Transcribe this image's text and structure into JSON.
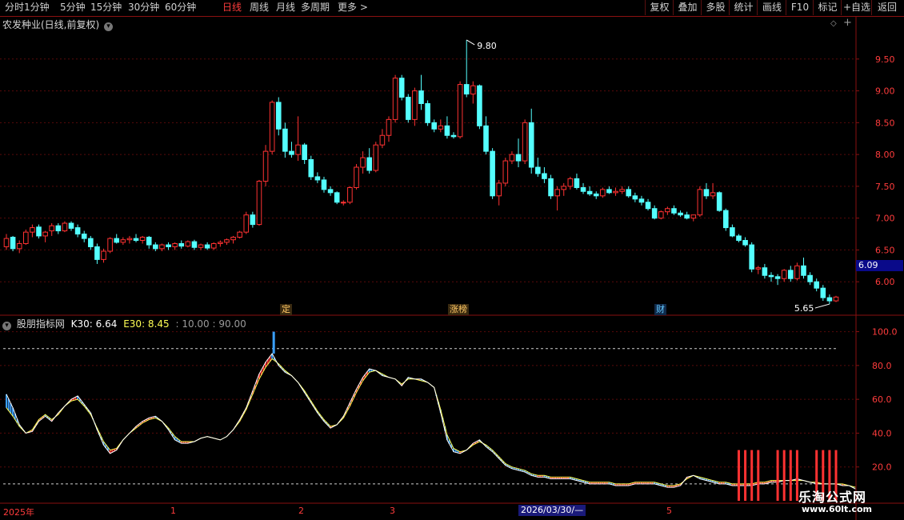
{
  "toolbar": {
    "periods": [
      "分时",
      "1分钟",
      "5分钟",
      "15分钟",
      "30分钟",
      "60分钟",
      "日线",
      "周线",
      "月线",
      "多周期",
      "更多 >"
    ],
    "active_period": "日线",
    "buttons": [
      "复权",
      "叠加",
      "多股",
      "统计",
      "画线",
      "F10",
      "标记",
      "+自选",
      "返回"
    ]
  },
  "stock_title": "农发种业(日线,前复权)",
  "indicator": {
    "name": "股朋指标网",
    "k30_label": "K30: 6.64",
    "e30_label": "E30: 8.45",
    "params": ": 10.00 : 90.00"
  },
  "annotations": {
    "high_label": "9.80",
    "low_label": "5.65",
    "current_price": "6.09",
    "event_1": "定",
    "event_2": "涨榜",
    "event_3": "财"
  },
  "x_axis": {
    "year": "2025年",
    "months": [
      "1",
      "2",
      "3",
      "5"
    ],
    "cursor_date": "2026/03/30/—"
  },
  "watermark": {
    "title": "乐淘公式网",
    "url": "www.60lt.com"
  },
  "colors": {
    "up": "#ff3232",
    "down": "#54ffff",
    "cursor": "#1a1a7a",
    "magenta": "#ff00ff",
    "blue": "#3aa0ff",
    "grid": "#5a0a0a"
  },
  "chart_data": [
    {
      "type": "candlestick",
      "title": "农发种业(日线,前复权)",
      "y_ticks": [
        6.0,
        6.5,
        7.0,
        7.5,
        8.0,
        8.5,
        9.0,
        9.5
      ],
      "ylim": [
        5.55,
        9.95
      ],
      "annotated_high": 9.8,
      "annotated_low": 5.65,
      "last_price": 6.09,
      "ohlc": [
        [
          6.55,
          6.75,
          6.5,
          6.68
        ],
        [
          6.7,
          6.72,
          6.48,
          6.52
        ],
        [
          6.52,
          6.65,
          6.45,
          6.6
        ],
        [
          6.6,
          6.82,
          6.58,
          6.78
        ],
        [
          6.78,
          6.9,
          6.7,
          6.85
        ],
        [
          6.86,
          6.9,
          6.68,
          6.72
        ],
        [
          6.72,
          6.8,
          6.62,
          6.78
        ],
        [
          6.8,
          6.92,
          6.72,
          6.88
        ],
        [
          6.88,
          6.92,
          6.75,
          6.8
        ],
        [
          6.8,
          6.95,
          6.78,
          6.92
        ],
        [
          6.92,
          6.95,
          6.8,
          6.84
        ],
        [
          6.85,
          6.9,
          6.7,
          6.75
        ],
        [
          6.75,
          6.8,
          6.62,
          6.68
        ],
        [
          6.68,
          6.72,
          6.5,
          6.55
        ],
        [
          6.55,
          6.6,
          6.28,
          6.35
        ],
        [
          6.35,
          6.52,
          6.3,
          6.48
        ],
        [
          6.48,
          6.7,
          6.45,
          6.68
        ],
        [
          6.68,
          6.75,
          6.6,
          6.62
        ],
        [
          6.62,
          6.7,
          6.58,
          6.66
        ],
        [
          6.66,
          6.72,
          6.6,
          6.68
        ],
        [
          6.68,
          6.75,
          6.62,
          6.65
        ],
        [
          6.65,
          6.72,
          6.6,
          6.7
        ],
        [
          6.7,
          6.72,
          6.52,
          6.58
        ],
        [
          6.58,
          6.62,
          6.48,
          6.52
        ],
        [
          6.52,
          6.6,
          6.48,
          6.58
        ],
        [
          6.58,
          6.62,
          6.5,
          6.55
        ],
        [
          6.55,
          6.62,
          6.5,
          6.6
        ],
        [
          6.6,
          6.65,
          6.52,
          6.56
        ],
        [
          6.56,
          6.65,
          6.54,
          6.63
        ],
        [
          6.63,
          6.66,
          6.5,
          6.54
        ],
        [
          6.54,
          6.6,
          6.5,
          6.58
        ],
        [
          6.58,
          6.62,
          6.5,
          6.53
        ],
        [
          6.53,
          6.62,
          6.5,
          6.6
        ],
        [
          6.6,
          6.65,
          6.55,
          6.62
        ],
        [
          6.62,
          6.68,
          6.58,
          6.66
        ],
        [
          6.66,
          6.72,
          6.6,
          6.7
        ],
        [
          6.7,
          6.8,
          6.68,
          6.78
        ],
        [
          6.78,
          7.1,
          6.75,
          7.05
        ],
        [
          7.05,
          7.1,
          6.85,
          6.9
        ],
        [
          6.9,
          7.6,
          6.88,
          7.58
        ],
        [
          7.58,
          8.15,
          7.5,
          8.05
        ],
        [
          8.05,
          8.85,
          8.0,
          8.82
        ],
        [
          8.82,
          8.9,
          8.3,
          8.4
        ],
        [
          8.4,
          8.5,
          7.95,
          8.05
        ],
        [
          8.05,
          8.2,
          7.95,
          8.0
        ],
        [
          8.0,
          8.6,
          7.9,
          8.15
        ],
        [
          8.15,
          8.18,
          7.85,
          7.92
        ],
        [
          7.92,
          7.98,
          7.6,
          7.65
        ],
        [
          7.65,
          7.72,
          7.55,
          7.6
        ],
        [
          7.6,
          7.65,
          7.4,
          7.45
        ],
        [
          7.45,
          7.5,
          7.35,
          7.4
        ],
        [
          7.4,
          7.42,
          7.22,
          7.25
        ],
        [
          7.25,
          7.28,
          7.2,
          7.25
        ],
        [
          7.25,
          7.5,
          7.22,
          7.48
        ],
        [
          7.48,
          7.85,
          7.45,
          7.8
        ],
        [
          7.8,
          8.05,
          7.7,
          7.95
        ],
        [
          7.95,
          8.1,
          7.7,
          7.75
        ],
        [
          7.75,
          8.2,
          7.72,
          8.15
        ],
        [
          8.15,
          8.4,
          8.1,
          8.3
        ],
        [
          8.3,
          8.6,
          8.2,
          8.55
        ],
        [
          8.55,
          9.25,
          8.5,
          9.2
        ],
        [
          9.2,
          9.25,
          8.85,
          8.9
        ],
        [
          8.9,
          8.95,
          8.5,
          8.55
        ],
        [
          8.55,
          9.05,
          8.45,
          9.0
        ],
        [
          9.0,
          9.25,
          8.7,
          8.8
        ],
        [
          8.8,
          8.85,
          8.45,
          8.5
        ],
        [
          8.5,
          8.55,
          8.35,
          8.4
        ],
        [
          8.4,
          8.55,
          8.35,
          8.45
        ],
        [
          8.45,
          8.6,
          8.25,
          8.3
        ],
        [
          8.3,
          8.35,
          8.25,
          8.28
        ],
        [
          8.28,
          9.15,
          8.25,
          9.1
        ],
        [
          9.1,
          9.8,
          8.9,
          8.95
        ],
        [
          8.95,
          9.15,
          8.8,
          9.08
        ],
        [
          9.08,
          9.1,
          8.4,
          8.45
        ],
        [
          8.45,
          8.6,
          8.0,
          8.05
        ],
        [
          8.05,
          8.1,
          7.3,
          7.35
        ],
        [
          7.35,
          7.6,
          7.2,
          7.55
        ],
        [
          7.55,
          7.95,
          7.5,
          7.9
        ],
        [
          7.9,
          8.05,
          7.85,
          8.0
        ],
        [
          8.0,
          8.25,
          7.8,
          7.9
        ],
        [
          7.9,
          8.55,
          7.85,
          8.5
        ],
        [
          8.5,
          8.72,
          7.7,
          7.8
        ],
        [
          7.8,
          7.95,
          7.65,
          7.7
        ],
        [
          7.7,
          7.8,
          7.55,
          7.62
        ],
        [
          7.62,
          7.68,
          7.3,
          7.35
        ],
        [
          7.35,
          7.5,
          7.12,
          7.45
        ],
        [
          7.45,
          7.55,
          7.35,
          7.5
        ],
        [
          7.5,
          7.65,
          7.45,
          7.62
        ],
        [
          7.62,
          7.7,
          7.45,
          7.48
        ],
        [
          7.48,
          7.55,
          7.38,
          7.42
        ],
        [
          7.42,
          7.5,
          7.35,
          7.38
        ],
        [
          7.38,
          7.42,
          7.3,
          7.35
        ],
        [
          7.35,
          7.48,
          7.32,
          7.45
        ],
        [
          7.45,
          7.5,
          7.38,
          7.4
        ],
        [
          7.4,
          7.48,
          7.35,
          7.42
        ],
        [
          7.42,
          7.5,
          7.38,
          7.45
        ],
        [
          7.45,
          7.5,
          7.32,
          7.35
        ],
        [
          7.35,
          7.4,
          7.25,
          7.3
        ],
        [
          7.3,
          7.35,
          7.2,
          7.25
        ],
        [
          7.25,
          7.3,
          7.12,
          7.15
        ],
        [
          7.15,
          7.2,
          6.98,
          7.0
        ],
        [
          7.0,
          7.12,
          6.98,
          7.1
        ],
        [
          7.1,
          7.18,
          7.05,
          7.15
        ],
        [
          7.15,
          7.2,
          7.05,
          7.08
        ],
        [
          7.08,
          7.12,
          7.02,
          7.05
        ],
        [
          7.05,
          7.1,
          6.98,
          7.0
        ],
        [
          7.0,
          7.05,
          6.95,
          7.05
        ],
        [
          7.05,
          7.5,
          7.02,
          7.45
        ],
        [
          7.45,
          7.55,
          7.3,
          7.35
        ],
        [
          7.35,
          7.55,
          7.3,
          7.4
        ],
        [
          7.4,
          7.42,
          7.1,
          7.12
        ],
        [
          7.12,
          7.15,
          6.8,
          6.85
        ],
        [
          6.85,
          6.9,
          6.7,
          6.72
        ],
        [
          6.72,
          6.75,
          6.62,
          6.65
        ],
        [
          6.65,
          6.7,
          6.55,
          6.58
        ],
        [
          6.58,
          6.62,
          6.15,
          6.2
        ],
        [
          6.2,
          6.25,
          6.12,
          6.22
        ],
        [
          6.22,
          6.28,
          6.05,
          6.1
        ],
        [
          6.1,
          6.15,
          6.0,
          6.08
        ],
        [
          6.08,
          6.12,
          5.95,
          6.05
        ],
        [
          6.05,
          6.2,
          6.0,
          6.18
        ],
        [
          6.18,
          6.25,
          6.0,
          6.05
        ],
        [
          6.05,
          6.3,
          6.02,
          6.25
        ],
        [
          6.25,
          6.38,
          6.05,
          6.1
        ],
        [
          6.1,
          6.15,
          5.95,
          6.0
        ],
        [
          6.0,
          6.05,
          5.85,
          5.9
        ],
        [
          5.9,
          5.95,
          5.7,
          5.75
        ],
        [
          5.75,
          5.8,
          5.65,
          5.7
        ],
        [
          5.7,
          5.78,
          5.68,
          5.76
        ]
      ]
    },
    {
      "type": "line",
      "name": "股朋指标网",
      "series": [
        {
          "name": "K30",
          "last": 6.64
        },
        {
          "name": "E30",
          "last": 8.45
        }
      ],
      "y_ticks": [
        20.0,
        40.0,
        60.0,
        80.0,
        100.0
      ],
      "ylim": [
        0,
        105
      ],
      "reference_lines": [
        10.0,
        90.0
      ],
      "k30": [
        63,
        55,
        45,
        40,
        41,
        47,
        50,
        47,
        52,
        56,
        60,
        62,
        57,
        52,
        42,
        33,
        28,
        30,
        36,
        40,
        44,
        47,
        49,
        50,
        47,
        42,
        36,
        34,
        34,
        35,
        37,
        38,
        37,
        36,
        38,
        42,
        48,
        55,
        65,
        75,
        82,
        87,
        80,
        76,
        74,
        70,
        64,
        58,
        52,
        47,
        43,
        45,
        50,
        58,
        66,
        73,
        78,
        77,
        74,
        73,
        72,
        68,
        73,
        72,
        72,
        70,
        67,
        52,
        36,
        29,
        28,
        30,
        34,
        36,
        32,
        29,
        25,
        21,
        19,
        18,
        17,
        15,
        14,
        14,
        13,
        13,
        13,
        13,
        12,
        11,
        10,
        10,
        10,
        10,
        9,
        9,
        9,
        10,
        10,
        10,
        10,
        9,
        8,
        8,
        9,
        14,
        15,
        13,
        12,
        11,
        10,
        10,
        9,
        9,
        9,
        9,
        10,
        10,
        11,
        11,
        12,
        12,
        13,
        12,
        11,
        10,
        10,
        10,
        10,
        9,
        9,
        7
      ],
      "e30": [
        55,
        50,
        44,
        40,
        42,
        48,
        51,
        48,
        51,
        56,
        59,
        60,
        56,
        51,
        43,
        35,
        30,
        31,
        36,
        40,
        43,
        46,
        48,
        49,
        47,
        43,
        38,
        35,
        35,
        35,
        37,
        38,
        37,
        36,
        38,
        42,
        47,
        54,
        63,
        72,
        79,
        84,
        81,
        77,
        74,
        70,
        65,
        59,
        53,
        48,
        44,
        45,
        49,
        56,
        64,
        71,
        76,
        77,
        75,
        73,
        72,
        69,
        72,
        72,
        71,
        70,
        67,
        54,
        39,
        31,
        29,
        30,
        33,
        35,
        33,
        30,
        26,
        22,
        20,
        19,
        18,
        16,
        15,
        15,
        14,
        14,
        14,
        14,
        13,
        12,
        11,
        11,
        11,
        11,
        10,
        10,
        10,
        11,
        11,
        11,
        11,
        10,
        9,
        9,
        10,
        13,
        15,
        14,
        13,
        12,
        11,
        11,
        10,
        10,
        10,
        10,
        11,
        11,
        12,
        12,
        12,
        12,
        12,
        12,
        11,
        11,
        10,
        10,
        10,
        10,
        9,
        8
      ]
    }
  ]
}
